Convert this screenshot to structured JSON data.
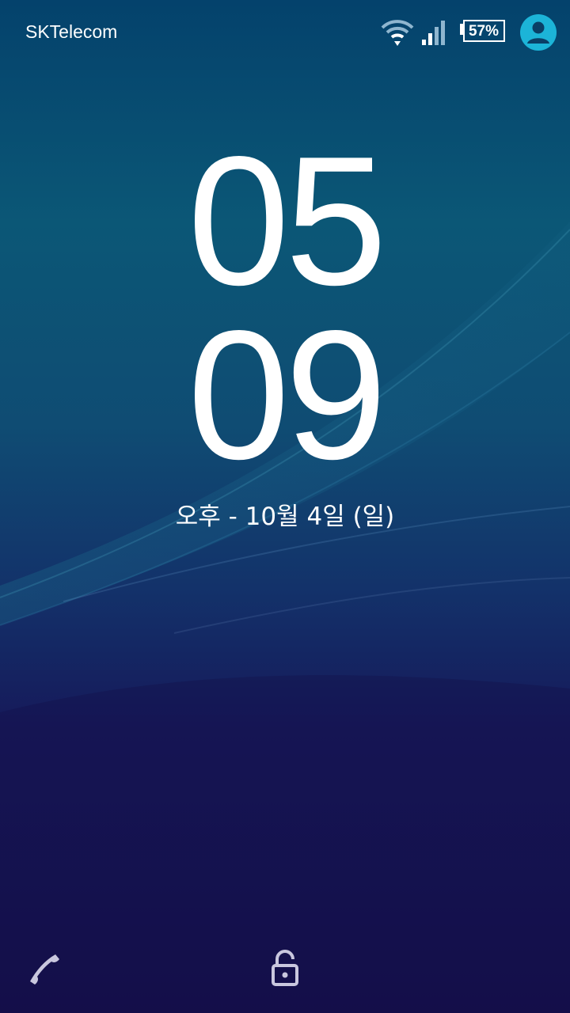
{
  "status_bar": {
    "carrier": "SKTelecom",
    "battery_percent": "57%",
    "icons": [
      "wifi-icon",
      "signal-icon",
      "battery-icon",
      "user-avatar-icon"
    ],
    "avatar_color": "#1cb4d8"
  },
  "lock_screen": {
    "hours": "05",
    "minutes": "09",
    "date": "오후 - 10월 4일 (일)"
  },
  "shortcuts": {
    "left_icon": "phone-icon",
    "center_icon": "unlock-icon"
  },
  "colors": {
    "text": "#ffffff",
    "shortcut_icon": "#c9c7de"
  }
}
